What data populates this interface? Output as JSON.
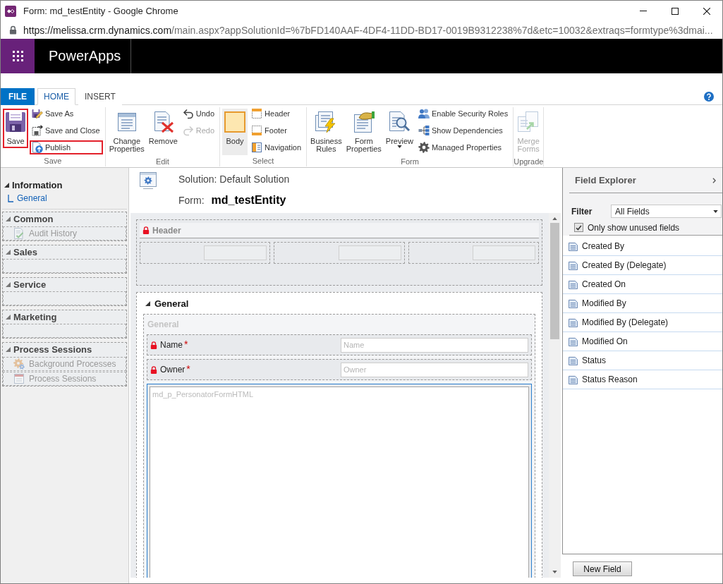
{
  "window": {
    "title": "Form: md_testEntity - Google Chrome"
  },
  "address_bar": {
    "host": "https://melissa.crm.dynamics.com",
    "path": "/main.aspx?appSolutionId=%7bFD140AAF-4DF4-11DD-BD17-0019B9312238%7d&etc=10032&extraqs=formtype%3dmai..."
  },
  "app_bar": {
    "title": "PowerApps"
  },
  "ribbon_tabs": [
    {
      "label": "FILE",
      "kind": "file",
      "selected": false
    },
    {
      "label": "HOME",
      "kind": "tab",
      "selected": true
    },
    {
      "label": "INSERT",
      "kind": "tab",
      "selected": false
    }
  ],
  "ribbon_groups": [
    {
      "label": "Save",
      "commands": [
        {
          "label": "Save",
          "kind": "large",
          "disabled": false,
          "highlighted": true,
          "dropdown": false
        },
        {
          "label": "Save As",
          "kind": "small",
          "disabled": false,
          "highlighted": false,
          "dropdown": false
        },
        {
          "label": "Save and Close",
          "kind": "small",
          "disabled": false,
          "highlighted": false,
          "dropdown": false
        },
        {
          "label": "Publish",
          "kind": "small",
          "disabled": false,
          "highlighted": true,
          "dropdown": false
        }
      ]
    },
    {
      "label": "Edit",
      "commands": [
        {
          "label": "Change Properties",
          "kind": "large",
          "disabled": false,
          "highlighted": false,
          "dropdown": false
        },
        {
          "label": "Remove",
          "kind": "large",
          "disabled": false,
          "highlighted": false,
          "dropdown": false
        },
        {
          "label": "Undo",
          "kind": "small",
          "disabled": false,
          "highlighted": false,
          "dropdown": false
        },
        {
          "label": "Redo",
          "kind": "small",
          "disabled": true,
          "highlighted": false,
          "dropdown": false
        }
      ]
    },
    {
      "label": "Select",
      "commands": [
        {
          "label": "Body",
          "kind": "large",
          "disabled": false,
          "highlighted": false,
          "dropdown": false,
          "selected": true
        },
        {
          "label": "Header",
          "kind": "small",
          "disabled": false,
          "highlighted": false,
          "dropdown": false,
          "selected": false
        },
        {
          "label": "Footer",
          "kind": "small",
          "disabled": false,
          "highlighted": false,
          "dropdown": false,
          "selected": false
        },
        {
          "label": "Navigation",
          "kind": "small",
          "disabled": false,
          "highlighted": false,
          "dropdown": false,
          "selected": false
        }
      ]
    },
    {
      "label": "Form",
      "commands": [
        {
          "label": "Business Rules",
          "kind": "large",
          "disabled": false,
          "highlighted": false,
          "dropdown": false
        },
        {
          "label": "Form Properties",
          "kind": "large",
          "disabled": false,
          "highlighted": false,
          "dropdown": false
        },
        {
          "label": "Preview",
          "kind": "large",
          "disabled": false,
          "highlighted": false,
          "dropdown": true
        },
        {
          "label": "Enable Security Roles",
          "kind": "small",
          "disabled": false,
          "highlighted": false,
          "dropdown": false
        },
        {
          "label": "Show Dependencies",
          "kind": "small",
          "disabled": false,
          "highlighted": false,
          "dropdown": false
        },
        {
          "label": "Managed Properties",
          "kind": "small",
          "disabled": false,
          "highlighted": false,
          "dropdown": false
        }
      ]
    },
    {
      "label": "Upgrade",
      "commands": [
        {
          "label": "Merge Forms",
          "kind": "large",
          "disabled": true,
          "highlighted": false,
          "dropdown": false
        }
      ]
    }
  ],
  "navigation": {
    "sections": [
      {
        "title": "Information",
        "kind": "tabs",
        "expanded": true,
        "items": [
          {
            "label": "General"
          }
        ]
      },
      {
        "title": "Common",
        "kind": "group",
        "expanded": true,
        "items": [
          {
            "label": "Audit History"
          }
        ]
      },
      {
        "title": "Sales",
        "kind": "group",
        "expanded": true
      },
      {
        "title": "Service",
        "kind": "group",
        "expanded": true
      },
      {
        "title": "Marketing",
        "kind": "group",
        "expanded": true
      },
      {
        "title": "Process Sessions",
        "kind": "group",
        "expanded": true,
        "items": [
          {
            "label": "Background Processes"
          },
          {
            "label": "Process Sessions"
          }
        ]
      }
    ]
  },
  "form_header": {
    "solution": "Solution: Default Solution",
    "form_label": "Form:",
    "form_name": "md_testEntity"
  },
  "form_canvas": {
    "header": {
      "title": "Header",
      "locked": true
    },
    "tabs": [
      {
        "title": "General",
        "expanded": true,
        "sections": [
          {
            "title": "General",
            "controls": [
              {
                "kind": "field",
                "label": "Name",
                "required_mark": "*",
                "placeholder": "Name",
                "locked": true,
                "selected": false
              },
              {
                "kind": "field",
                "label": "Owner",
                "required_mark": "*",
                "placeholder": "Owner",
                "locked": true,
                "selected": false
              },
              {
                "kind": "web_resource",
                "name": "md_p_PersonatorFormHTML",
                "selected": true
              }
            ]
          }
        ]
      }
    ]
  },
  "field_explorer": {
    "title": "Field Explorer",
    "filter": {
      "label": "Filter",
      "value": "All Fields"
    },
    "unused_only": {
      "label": "Only show unused fields",
      "checked": true
    },
    "fields": [
      "Created By",
      "Created By (Delegate)",
      "Created On",
      "Modified By",
      "Modified By (Delegate)",
      "Modified On",
      "Status",
      "Status Reason"
    ],
    "new_field_button": "New Field"
  }
}
